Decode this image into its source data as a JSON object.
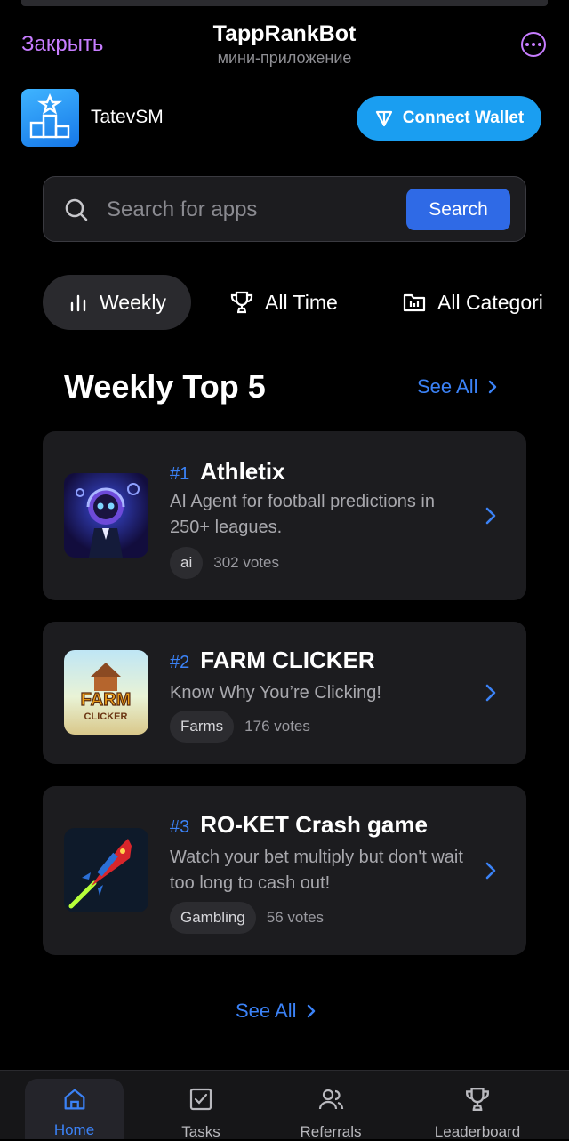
{
  "header": {
    "close_label": "Закрыть",
    "title": "TappRankBot",
    "subtitle": "мини-приложение",
    "more_icon": "more-horizontal-icon"
  },
  "account": {
    "username": "TatevSM",
    "connect_wallet_label": "Connect Wallet",
    "wallet_icon": "ton-logo-icon"
  },
  "search": {
    "placeholder": "Search for apps",
    "value": "",
    "button_label": "Search"
  },
  "tabs": [
    {
      "label": "Weekly",
      "icon": "bar-chart-icon",
      "active": true
    },
    {
      "label": "All Time",
      "icon": "trophy-icon",
      "active": false
    },
    {
      "label": "All Categori",
      "icon": "folder-icon",
      "active": false
    }
  ],
  "section": {
    "title": "Weekly Top 5",
    "see_all_label": "See All"
  },
  "apps": [
    {
      "rank": "#1",
      "name": "Athletix",
      "description": "AI Agent for football predictions in 250+ leagues.",
      "tag": "ai",
      "votes": "302 votes"
    },
    {
      "rank": "#2",
      "name": "FARM CLICKER",
      "description": "Know Why You’re Clicking!",
      "tag": "Farms",
      "votes": "176 votes",
      "icon_text_top": "FARM",
      "icon_text_bottom": "CLICKER"
    },
    {
      "rank": "#3",
      "name": "RO-KET Crash game",
      "description": "Watch your bet multiply but don't wait too long to cash out!",
      "tag": "Gambling",
      "votes": "56 votes"
    }
  ],
  "bottom_see_all_label": "See All",
  "nav": [
    {
      "label": "Home",
      "icon": "home-icon",
      "active": true
    },
    {
      "label": "Tasks",
      "icon": "checkbox-icon",
      "active": false
    },
    {
      "label": "Referrals",
      "icon": "users-icon",
      "active": false
    },
    {
      "label": "Leaderboard",
      "icon": "trophy-icon",
      "active": false
    }
  ],
  "colors": {
    "accent": "#3b82f6",
    "close_link": "#c77dff",
    "wallet": "#1a9ef1",
    "search_button": "#2f6ae6",
    "card_bg": "#1c1c1f"
  }
}
